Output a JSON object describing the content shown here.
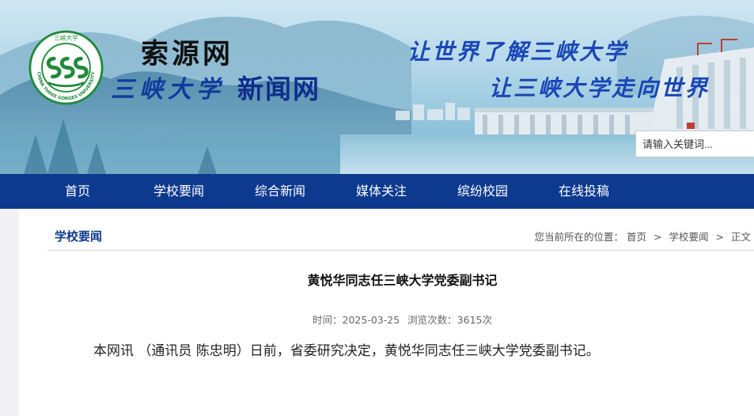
{
  "header": {
    "site_name": "索源网",
    "university_calligraphy": "三峡大学",
    "news_network": "新闻网",
    "slogan_line1": "让世界了解三峡大学",
    "slogan_line2": "让三峡大学走向世界",
    "logo_ring_text": "CHINA THREE GORGES UNIVERSITY",
    "logo_top_text": "三峡大学",
    "logo_color": "#1f8a3a",
    "search": {
      "placeholder": "请输入关键词..."
    }
  },
  "nav": {
    "background": "#0d3a8f",
    "items": [
      {
        "label": "首页"
      },
      {
        "label": "学校要闻"
      },
      {
        "label": "综合新闻"
      },
      {
        "label": "媒体关注"
      },
      {
        "label": "缤纷校园"
      },
      {
        "label": "在线投稿"
      }
    ]
  },
  "section": {
    "title": "学校要闻",
    "breadcrumb": {
      "prefix": "您当前所在的位置：",
      "items": [
        "首页",
        "学校要闻",
        "正文"
      ],
      "separator": ">"
    }
  },
  "article": {
    "title": "黄悦华同志任三峡大学党委副书记",
    "time": "时间：2025-03-25",
    "views": "浏览次数：3615次",
    "body": "本网讯 （通讯员 陈忠明）日前，省委研究决定，黄悦华同志任三峡大学党委副书记。"
  }
}
